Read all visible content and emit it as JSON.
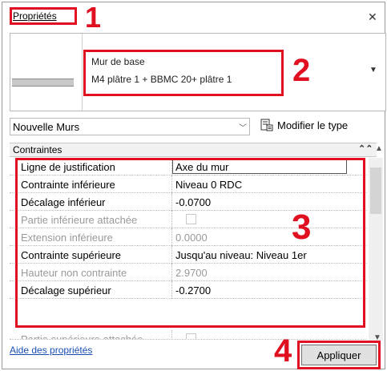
{
  "palette": {
    "title": "Propriétés",
    "close_icon": "close-icon"
  },
  "type_preview": {
    "line1": "Mur de base",
    "line2": "M4 plâtre 1 + BBMC 20+ plâtre 1"
  },
  "type_selector": {
    "value": "Nouvelle Murs",
    "edit_type_label": "Modifier le type"
  },
  "section": {
    "title": "Contraintes"
  },
  "properties": [
    {
      "label": "Ligne de justification",
      "value": "Axe du mur",
      "dim": false
    },
    {
      "label": "Contrainte inférieure",
      "value": "Niveau 0 RDC",
      "dim": false
    },
    {
      "label": "Décalage inférieur",
      "value": "-0.0700",
      "dim": false
    },
    {
      "label": "Partie inférieure attachée",
      "value": "",
      "dim": true,
      "checkbox": true
    },
    {
      "label": "Extension inférieure",
      "value": "0.0000",
      "dim": true
    },
    {
      "label": "Contrainte supérieure",
      "value": "Jusqu'au niveau: Niveau 1er",
      "dim": false
    },
    {
      "label": "Hauteur non contrainte",
      "value": "2.9700",
      "dim": true
    },
    {
      "label": "Décalage supérieur",
      "value": "-0.2700",
      "dim": false
    },
    {
      "label": "Partie supérieure attachée",
      "value": "",
      "dim": true,
      "checkbox": true
    }
  ],
  "footer": {
    "help_link": "Aide des propriétés",
    "apply_label": "Appliquer"
  },
  "annotations": {
    "n1": "1",
    "n2": "2",
    "n3": "3",
    "n4": "4"
  },
  "colors": {
    "annotation_red": "#e01020",
    "link_blue": "#1a4fb5"
  }
}
